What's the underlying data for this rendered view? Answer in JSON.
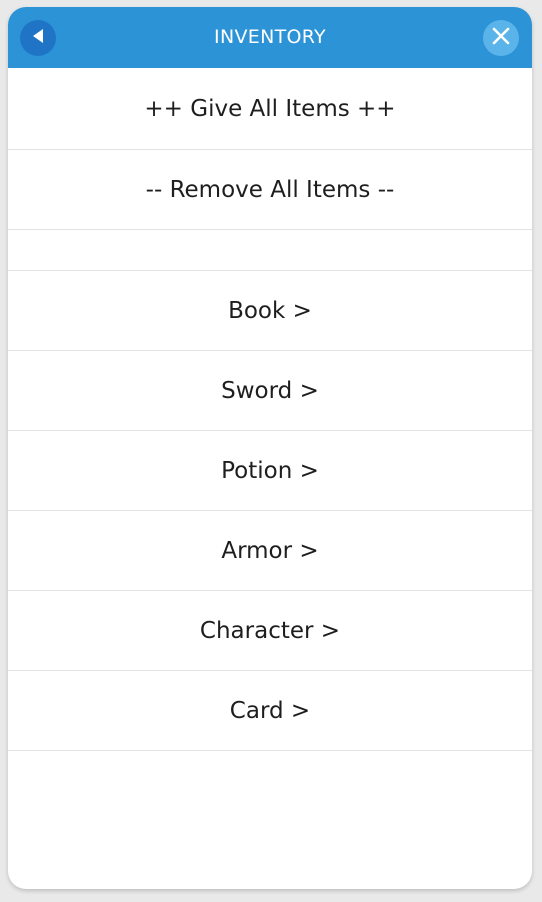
{
  "header": {
    "title": "INVENTORY",
    "back_icon": "back-triangle-icon",
    "close_icon": "close-x-icon"
  },
  "actions": {
    "give_all": "++ Give All Items ++",
    "remove_all": "-- Remove All Items --"
  },
  "categories": [
    {
      "label": "Book >"
    },
    {
      "label": "Sword >"
    },
    {
      "label": "Potion >"
    },
    {
      "label": "Armor >"
    },
    {
      "label": "Character >"
    },
    {
      "label": "Card >"
    }
  ],
  "colors": {
    "header_bg": "#2b93d6",
    "back_button": "#1f74c6",
    "close_button": "#5ab4ea"
  }
}
